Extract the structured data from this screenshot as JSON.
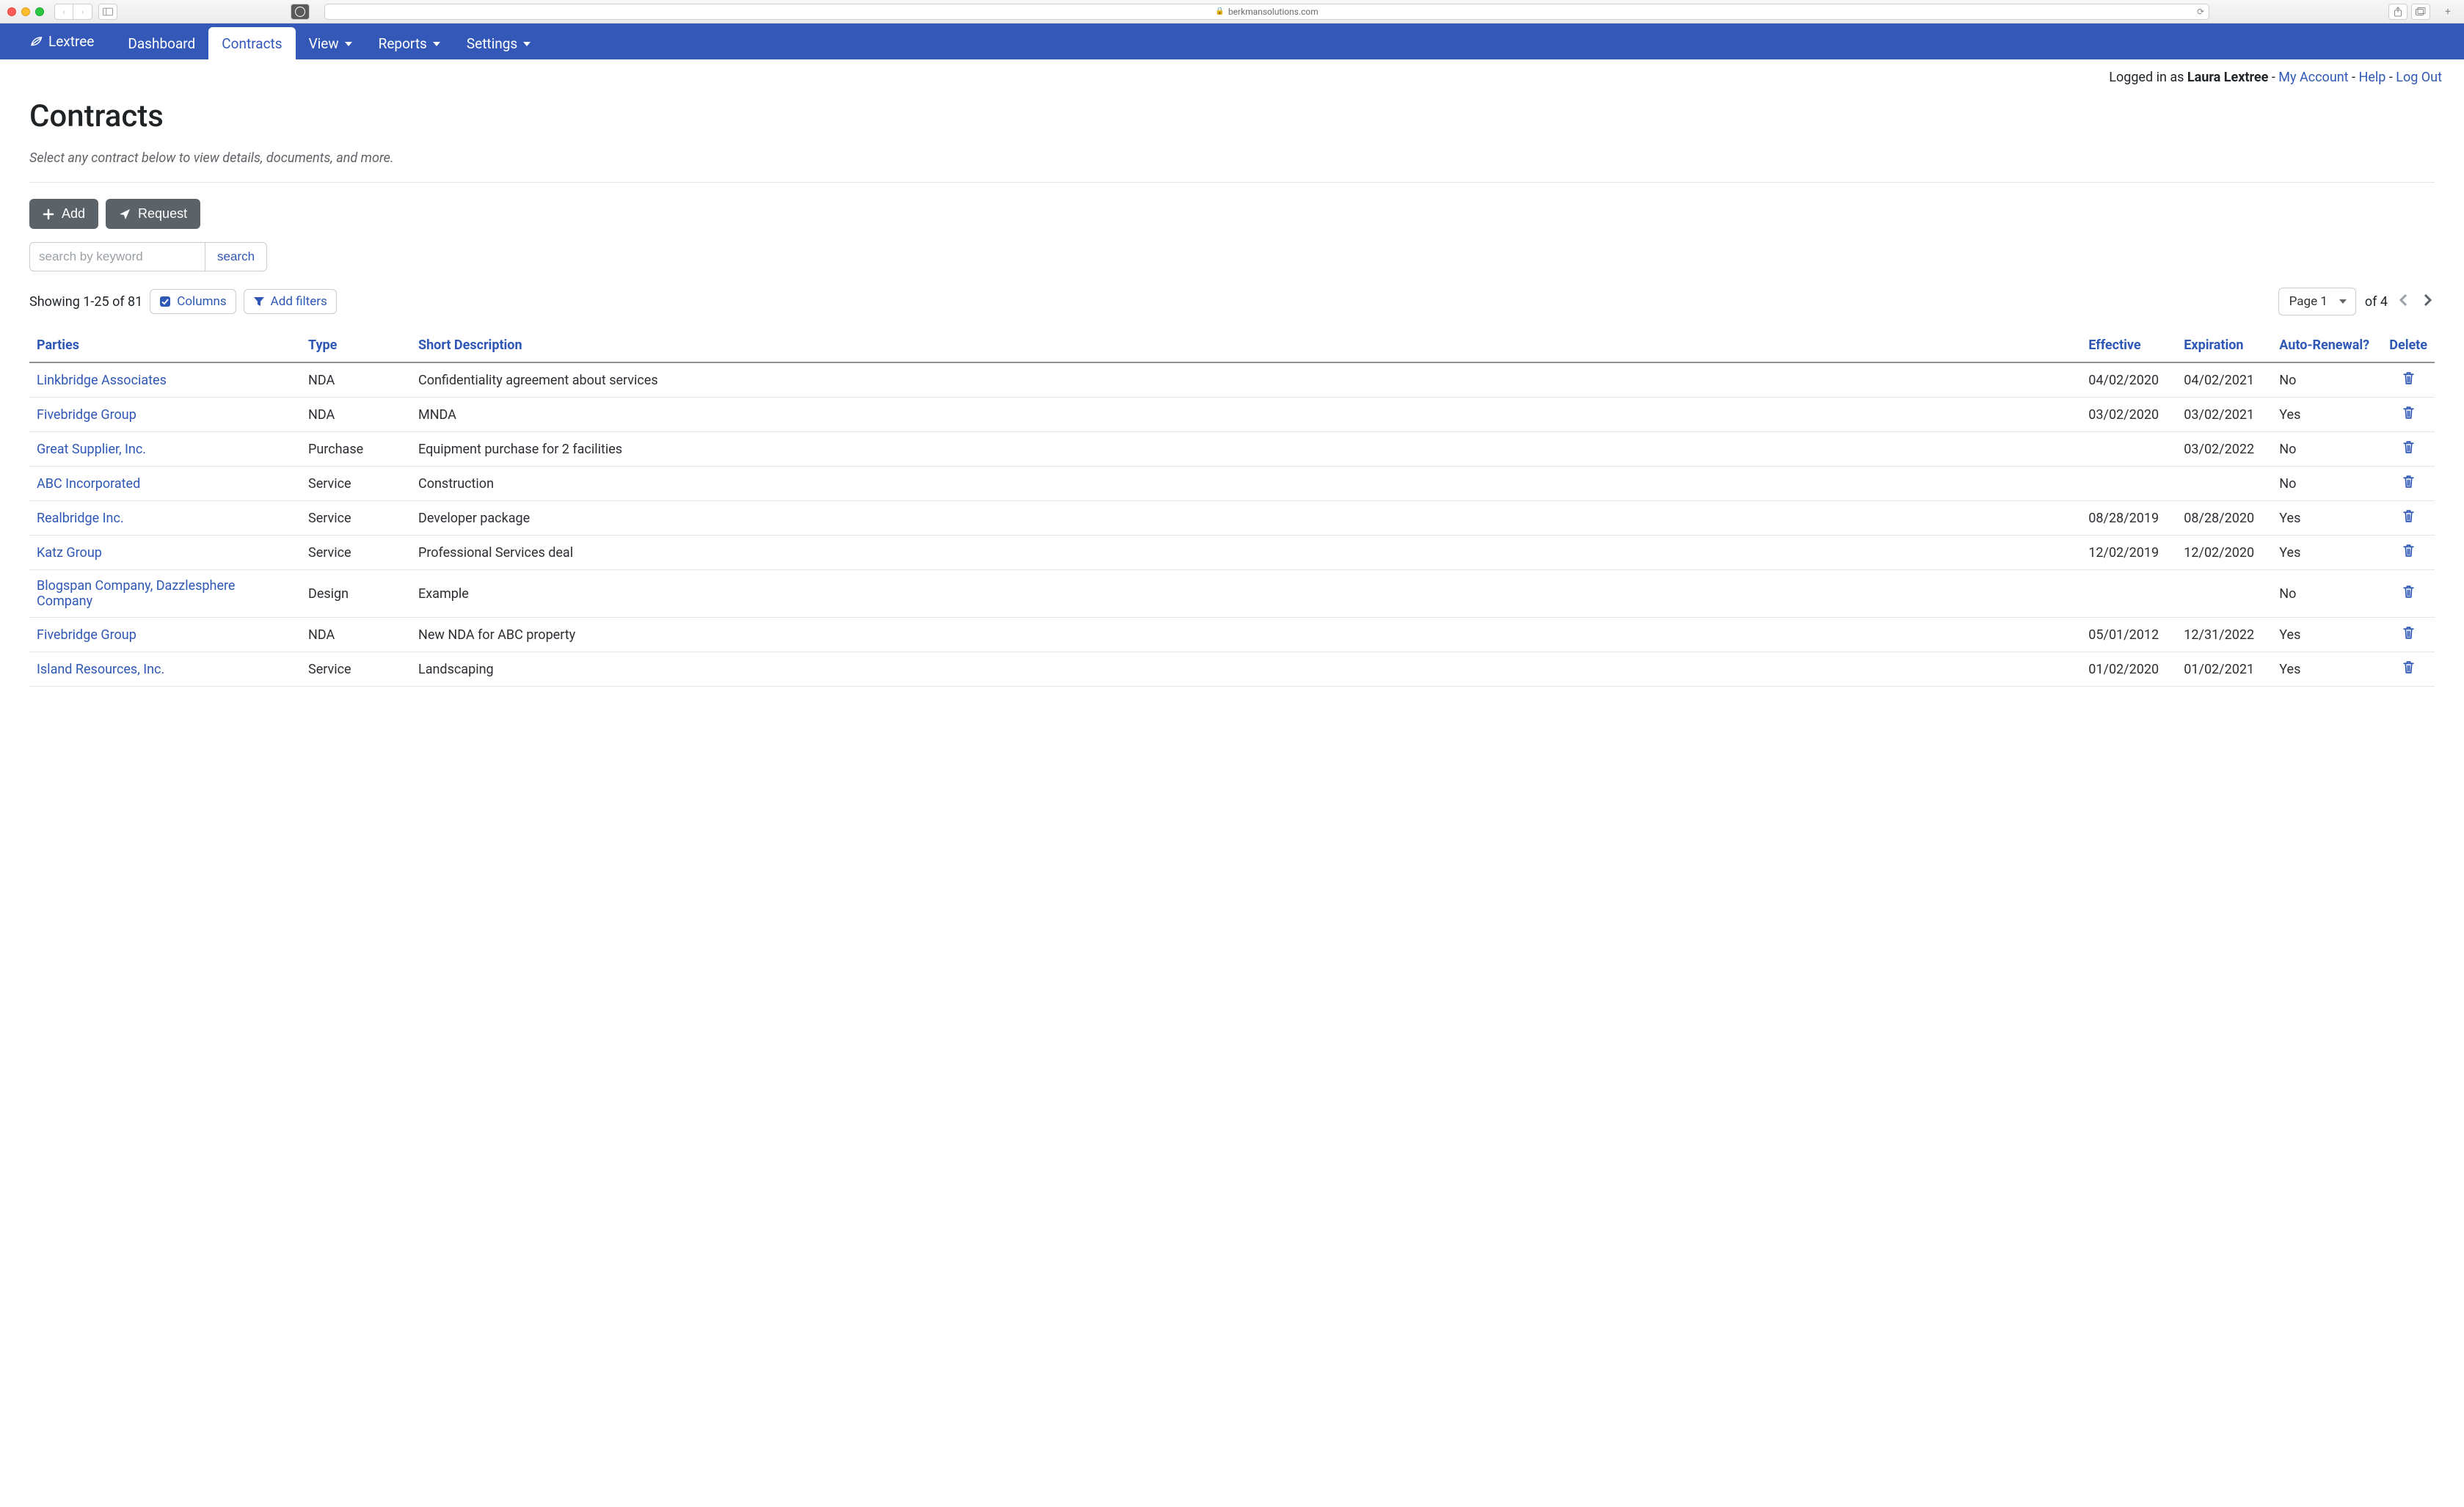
{
  "browser": {
    "domain": "berkmansolutions.com"
  },
  "brand": "Lextree",
  "nav": {
    "dashboard": "Dashboard",
    "contracts": "Contracts",
    "view": "View",
    "reports": "Reports",
    "settings": "Settings"
  },
  "account": {
    "prefix": "Logged in as ",
    "user": "Laura Lextree",
    "sep": " - ",
    "my_account": "My Account",
    "help": "Help",
    "logout": "Log Out"
  },
  "page": {
    "title": "Contracts",
    "subtitle": "Select any contract below to view details, documents, and more."
  },
  "buttons": {
    "add": "Add",
    "request": "Request"
  },
  "search": {
    "placeholder": "search by keyword",
    "button": "search"
  },
  "listing": {
    "showing": "Showing 1-25 of 81",
    "columns_btn": "Columns",
    "filters_btn": "Add filters",
    "page_label": "Page 1",
    "page_of": "of 4"
  },
  "columns": {
    "parties": "Parties",
    "type": "Type",
    "short": "Short Description",
    "effective": "Effective",
    "expiration": "Expiration",
    "auto": "Auto-Renewal?",
    "delete": "Delete"
  },
  "rows": [
    {
      "parties": "Linkbridge Associates",
      "type": "NDA",
      "short": "Confidentiality agreement about services",
      "effective": "04/02/2020",
      "expiration": "04/02/2021",
      "auto": "No"
    },
    {
      "parties": "Fivebridge Group",
      "type": "NDA",
      "short": "MNDA",
      "effective": "03/02/2020",
      "expiration": "03/02/2021",
      "auto": "Yes"
    },
    {
      "parties": "Great Supplier, Inc.",
      "type": "Purchase",
      "short": "Equipment purchase for 2 facilities",
      "effective": "",
      "expiration": "03/02/2022",
      "auto": "No"
    },
    {
      "parties": "ABC Incorporated",
      "type": "Service",
      "short": "Construction",
      "effective": "",
      "expiration": "",
      "auto": "No"
    },
    {
      "parties": "Realbridge Inc.",
      "type": "Service",
      "short": "Developer package",
      "effective": "08/28/2019",
      "expiration": "08/28/2020",
      "auto": "Yes"
    },
    {
      "parties": "Katz Group",
      "type": "Service",
      "short": "Professional Services deal",
      "effective": "12/02/2019",
      "expiration": "12/02/2020",
      "auto": "Yes"
    },
    {
      "parties": "Blogspan Company, Dazzlesphere Company",
      "type": "Design",
      "short": "Example",
      "effective": "",
      "expiration": "",
      "auto": "No"
    },
    {
      "parties": "Fivebridge Group",
      "type": "NDA",
      "short": "New NDA for ABC property",
      "effective": "05/01/2012",
      "expiration": "12/31/2022",
      "auto": "Yes"
    },
    {
      "parties": "Island Resources, Inc.",
      "type": "Service",
      "short": "Landscaping",
      "effective": "01/02/2020",
      "expiration": "01/02/2021",
      "auto": "Yes"
    }
  ]
}
